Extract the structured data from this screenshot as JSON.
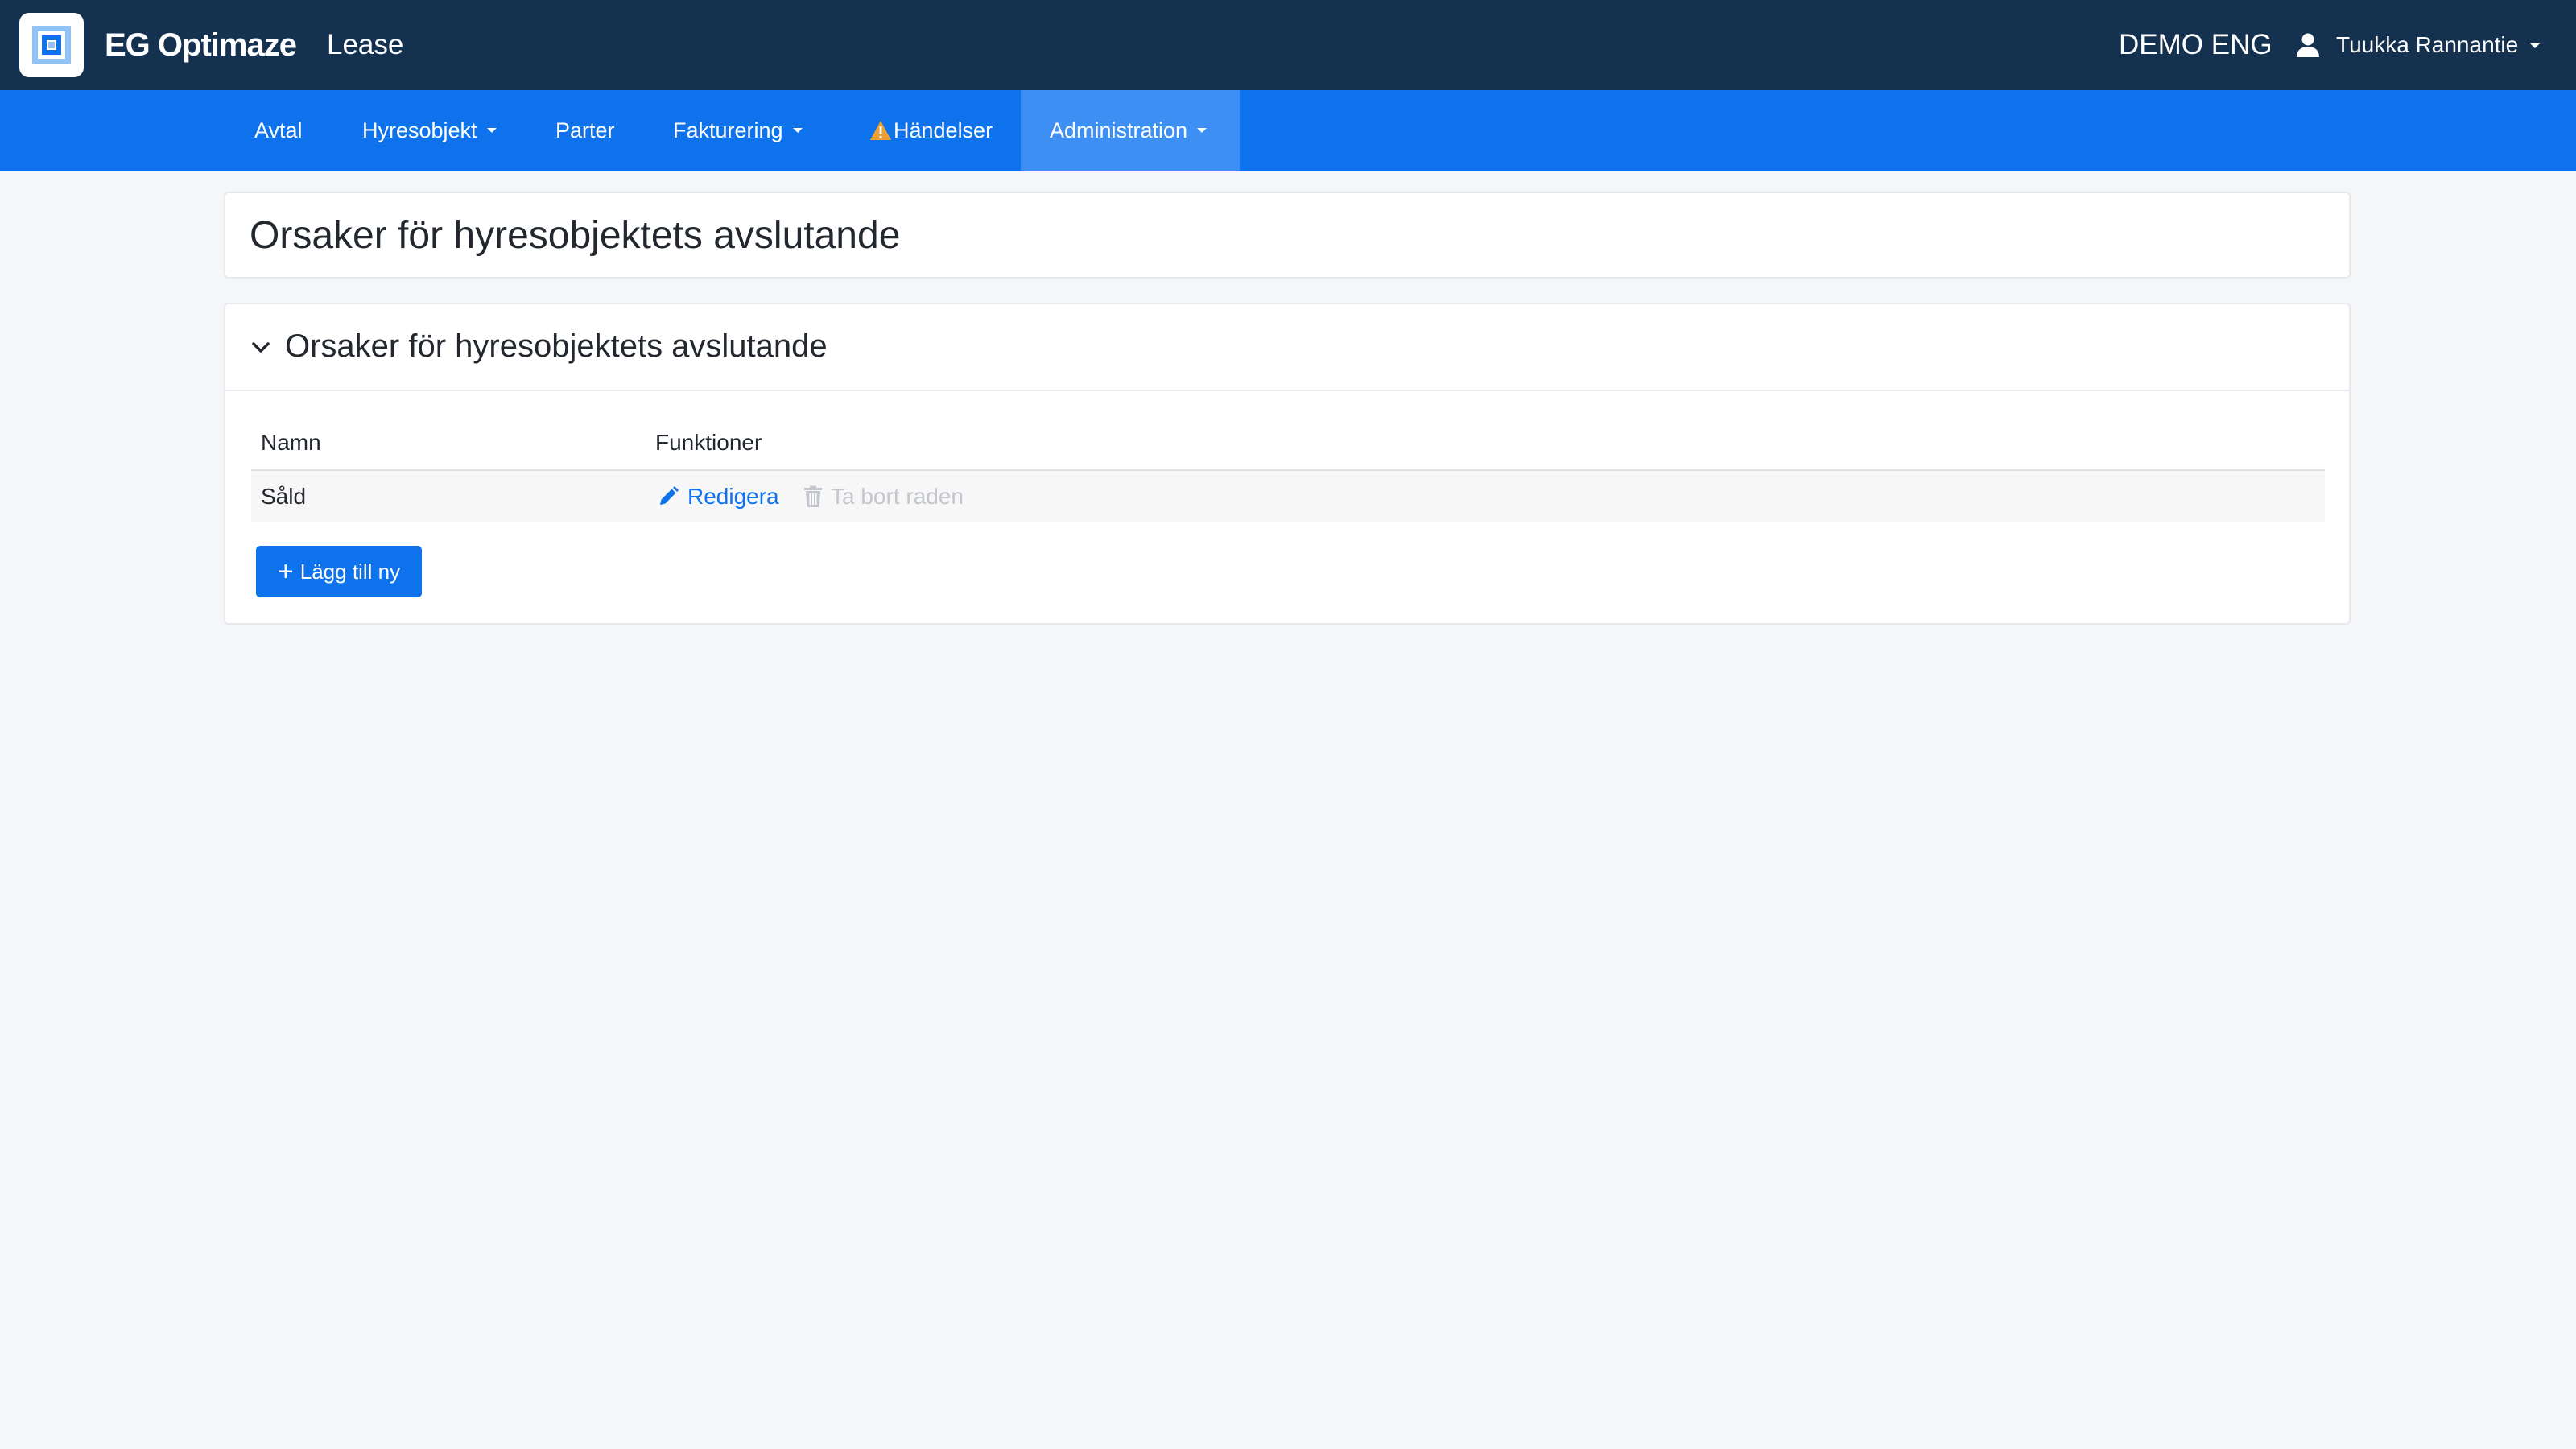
{
  "header": {
    "app_name": "EG Optimaze",
    "module": "Lease",
    "tenant": "DEMO ENG",
    "user_name": "Tuukka Rannantie"
  },
  "nav": {
    "items": [
      {
        "label": "Avtal"
      },
      {
        "label": "Hyresobjekt"
      },
      {
        "label": "Parter"
      },
      {
        "label": "Fakturering"
      },
      {
        "label": "Händelser"
      },
      {
        "label": "Administration"
      }
    ],
    "active": "Administration"
  },
  "page": {
    "title": "Orsaker för hyresobjektets avslutande"
  },
  "section": {
    "title": "Orsaker för hyresobjektets avslutande",
    "columns": [
      "Namn",
      "Funktioner"
    ],
    "rows": [
      {
        "name": "Såld",
        "edit_label": "Redigera",
        "delete_label": "Ta bort raden"
      }
    ],
    "add_label": "Lägg till ny"
  },
  "colors": {
    "header_bg": "#14314f",
    "nav_bg": "#0e72ec",
    "nav_active_bg": "#3d8ff3",
    "accent": "#0e72ec",
    "warning": "#f0a030",
    "disabled_text": "#c3c7cd"
  },
  "icons": [
    "app-logo-icon",
    "user-icon",
    "warning-icon",
    "chevron-down-icon",
    "pencil-icon",
    "trash-icon",
    "plus-icon"
  ]
}
